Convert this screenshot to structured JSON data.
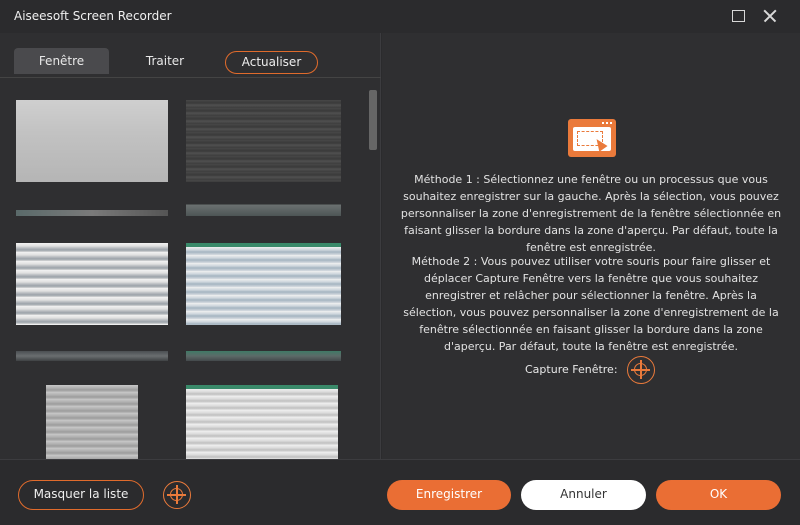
{
  "window": {
    "title": "Aiseesoft Screen Recorder"
  },
  "tabs": {
    "fenetre": "Fenêtre",
    "traiter": "Traiter",
    "refresh": "Actualiser"
  },
  "instructions": {
    "method1": "Méthode 1 : Sélectionnez une fenêtre ou un processus que vous souhaitez enregistrer sur la gauche. Après la sélection, vous pouvez personnaliser la zone d'enregistrement de la fenêtre sélectionnée en faisant glisser la bordure dans la zone d'aperçu. Par défaut, toute la fenêtre est enregistrée.",
    "method2": "Méthode 2 : Vous pouvez utiliser votre souris pour faire glisser et déplacer Capture Fenêtre vers la fenêtre que vous souhaitez enregistrer et relâcher pour sélectionner la fenêtre. Après la sélection, vous pouvez personnaliser la zone d'enregistrement de la fenêtre sélectionnée en faisant glisser la bordure dans la zone d'aperçu. Par défaut, toute la fenêtre est enregistrée.",
    "capture_label": "Capture Fenêtre:"
  },
  "buttons": {
    "hide_list": "Masquer la liste",
    "record": "Enregistrer",
    "cancel": "Annuler",
    "ok": "OK"
  },
  "colors": {
    "accent": "#ea6e34",
    "background": "#2b2b2d"
  }
}
